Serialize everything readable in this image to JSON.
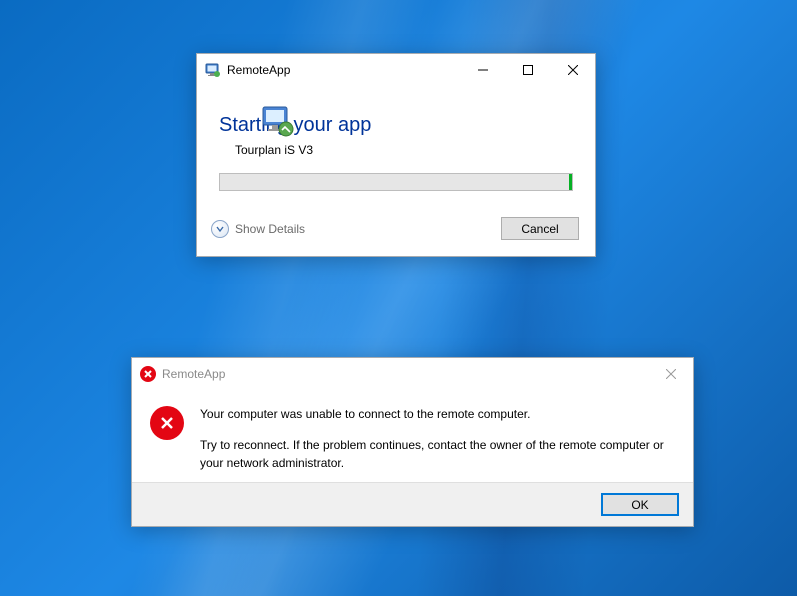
{
  "dialog1": {
    "title": "RemoteApp",
    "heading": "Starting your app",
    "app_name": "Tourplan iS V3",
    "show_details_label": "Show Details",
    "cancel_label": "Cancel"
  },
  "dialog2": {
    "title": "RemoteApp",
    "message_line1": "Your computer was unable to connect to the remote computer.",
    "message_line2": "Try to reconnect. If the problem continues, contact the owner of the remote computer or your network administrator.",
    "ok_label": "OK"
  }
}
